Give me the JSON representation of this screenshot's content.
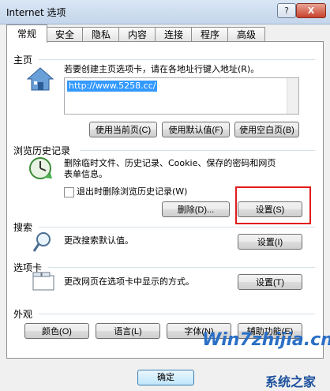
{
  "window": {
    "title": "Internet 选项",
    "help_label": "?",
    "close_label": "X"
  },
  "tabs": [
    {
      "label": "常规"
    },
    {
      "label": "安全"
    },
    {
      "label": "隐私"
    },
    {
      "label": "内容"
    },
    {
      "label": "连接"
    },
    {
      "label": "程序"
    },
    {
      "label": "高级"
    }
  ],
  "homepage": {
    "section": "主页",
    "description": "若要创建主页选项卡，请在各地址行键入地址(R)。",
    "url": "http://www.5258.cc/",
    "buttons": {
      "use_current": "使用当前页(C)",
      "use_default": "使用默认值(F)",
      "use_blank": "使用空白页(B)"
    }
  },
  "history": {
    "section": "浏览历史记录",
    "description_line1": "删除临时文件、历史记录、Cookie、保存的密码和网页",
    "description_line2": "表单信息。",
    "checkbox_label": "退出时删除浏览历史记录(W)",
    "checkbox_checked": false,
    "delete_button": "删除(D)...",
    "settings_button": "设置(S)"
  },
  "search": {
    "section": "搜索",
    "description": "更改搜索默认值。",
    "settings_button": "设置(I)"
  },
  "tabs_section": {
    "section": "选项卡",
    "description": "更改网页在选项卡中显示的方式。",
    "settings_button": "设置(T)"
  },
  "appearance": {
    "section": "外观",
    "buttons": {
      "colors": "颜色(O)",
      "languages": "语言(L)",
      "fonts": "字体(N)",
      "accessibility": "辅助功能(E)"
    }
  },
  "footer": {
    "ok_label": "确定"
  },
  "watermark": {
    "text1": "Win7zhijia.cn",
    "text2": "系统之家"
  }
}
